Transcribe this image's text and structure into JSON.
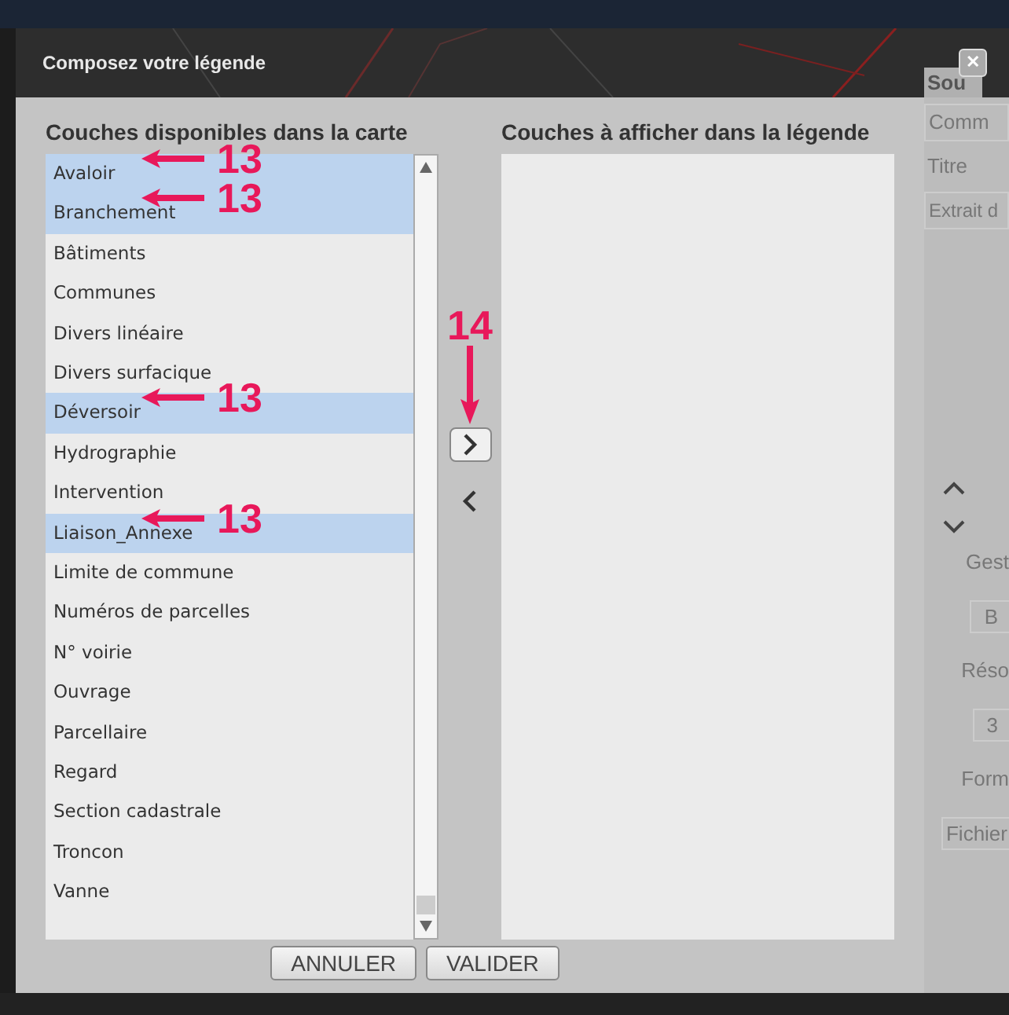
{
  "dialog": {
    "title": "Composez votre légende",
    "close": "✕"
  },
  "available": {
    "heading": "Couches disponibles dans la carte",
    "items": [
      {
        "label": "Avaloir",
        "selected": true,
        "note": "13"
      },
      {
        "label": "Branchement",
        "selected": true,
        "note": "13"
      },
      {
        "label": "Bâtiments",
        "selected": false
      },
      {
        "label": "Communes",
        "selected": false
      },
      {
        "label": "Divers linéaire",
        "selected": false
      },
      {
        "label": "Divers surfacique",
        "selected": false
      },
      {
        "label": "Déversoir",
        "selected": true,
        "note": "13"
      },
      {
        "label": "Hydrographie",
        "selected": false
      },
      {
        "label": "Intervention",
        "selected": false
      },
      {
        "label": "Liaison_Annexe",
        "selected": true,
        "note": "13"
      },
      {
        "label": "Limite de commune",
        "selected": false
      },
      {
        "label": "Numéros de parcelles",
        "selected": false
      },
      {
        "label": "N° voirie",
        "selected": false
      },
      {
        "label": "Ouvrage",
        "selected": false
      },
      {
        "label": "Parcellaire",
        "selected": false
      },
      {
        "label": "Regard",
        "selected": false
      },
      {
        "label": "Section cadastrale",
        "selected": false
      },
      {
        "label": "Troncon",
        "selected": false
      },
      {
        "label": "Vanne",
        "selected": false
      }
    ]
  },
  "shown": {
    "heading": "Couches à afficher dans la légende"
  },
  "move_note": "14",
  "buttons": [
    "ANNULER",
    "VALIDER"
  ],
  "side_panel": {
    "items": [
      "Sou",
      "Comm",
      "Titre",
      "Extrait d",
      "Gest",
      "B",
      "Réso",
      "3",
      "Form",
      "Fichier"
    ]
  }
}
